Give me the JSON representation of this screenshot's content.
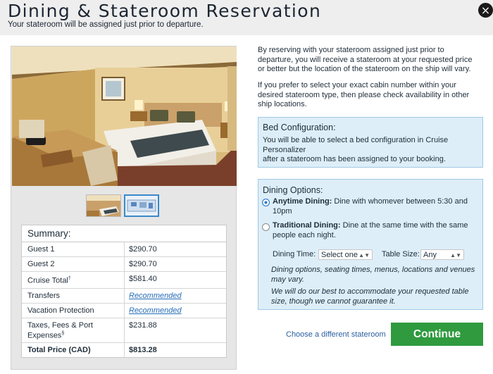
{
  "header": {
    "title": "Dining & Stateroom Reservation",
    "subtitle": "Your stateroom will be assigned just prior to departure.",
    "close_icon": "×"
  },
  "gallery": {
    "thumb_count": 2,
    "selected_index": 1
  },
  "summary": {
    "title": "Summary:",
    "rows": [
      {
        "label": "Guest 1",
        "sup": "",
        "value": "$290.70",
        "link": false
      },
      {
        "label": "Guest 2",
        "sup": "",
        "value": "$290.70",
        "link": false
      },
      {
        "label": "Cruise Total",
        "sup": "†",
        "value": "$581.40",
        "link": false
      },
      {
        "label": "Transfers",
        "sup": "",
        "value": "Recommended",
        "link": true
      },
      {
        "label": "Vacation Protection",
        "sup": "",
        "value": "Recommended",
        "link": true
      },
      {
        "label": "Taxes, Fees & Port Expenses",
        "sup": "§",
        "value": "$231.88",
        "link": false
      },
      {
        "label": "Total Price (CAD)",
        "sup": "",
        "value": "$813.28",
        "link": false,
        "total": true
      }
    ]
  },
  "intro": {
    "p1": "By reserving with your stateroom assigned just prior to departure, you will receive a stateroom at your requested price or better but the location of the stateroom on the ship will vary.",
    "p2": "If you prefer to select your exact cabin number within your desired stateroom type, then please check availability in other ship locations."
  },
  "bed_config": {
    "title": "Bed Configuration:",
    "line1": "You will be able to select a bed configuration in Cruise Personalizer",
    "line2": "after a stateroom has been assigned to your booking."
  },
  "dining": {
    "title": "Dining Options:",
    "option1_label": "Anytime Dining:",
    "option1_text": " Dine with whomever between 5:30 and 10pm",
    "option2_label": "Traditional Dining:",
    "option2_text": " Dine at the same time with the same people each night.",
    "selected_option": 1,
    "time_label": "Dining Time:",
    "time_value": "Select one",
    "size_label": "Table Size:",
    "size_value": "Any",
    "note1": "Dining options, seating times, menus, locations and venues may vary.",
    "note2": "We will do our best to accommodate your requested table size, though we cannot guarantee it."
  },
  "actions": {
    "change_link": "Choose a different stateroom",
    "continue_label": "Continue"
  },
  "colors": {
    "accent_green": "#2f9a3e",
    "info_box": "#ddeef8",
    "link_blue": "#2a6eb8"
  }
}
